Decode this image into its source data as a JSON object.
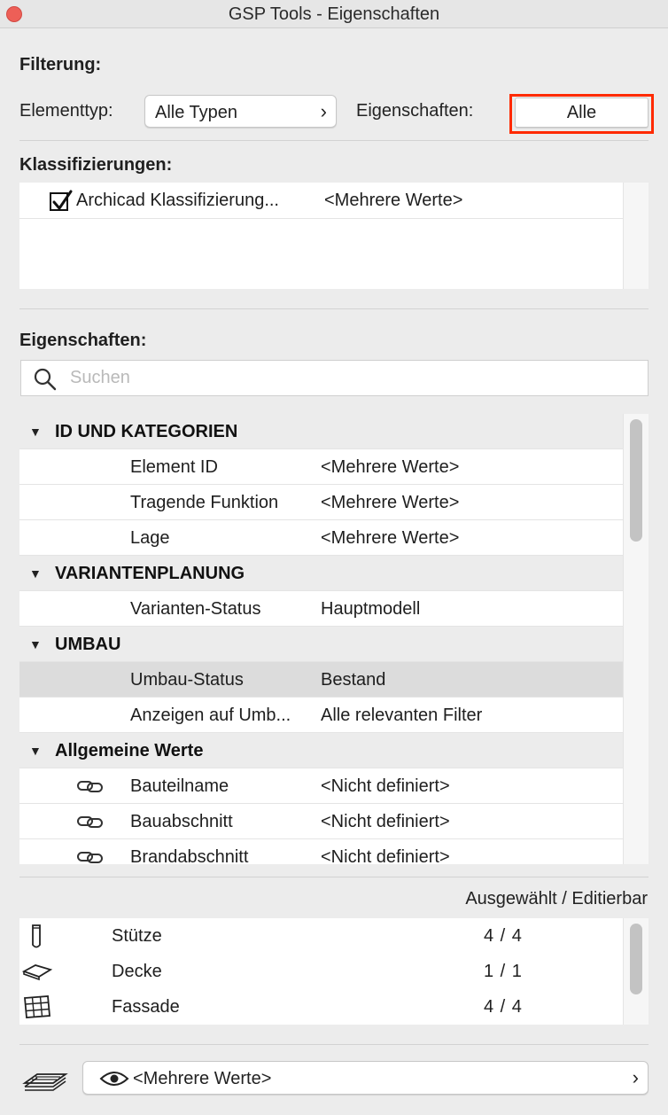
{
  "window": {
    "title": "GSP Tools - Eigenschaften"
  },
  "filter": {
    "heading": "Filterung:",
    "element_type_label": "Elementtyp:",
    "element_type_value": "Alle Typen",
    "properties_label": "Eigenschaften:",
    "properties_value": "Alle",
    "highlight_color": "#ff2a00"
  },
  "classifications": {
    "heading": "Klassifizierungen:",
    "items": [
      {
        "name": "Archicad Klassifizierung...",
        "value": "<Mehrere Werte>",
        "checked": true
      }
    ]
  },
  "properties": {
    "heading": "Eigenschaften:",
    "search_placeholder": "Suchen",
    "groups": [
      {
        "name": "ID UND KATEGORIEN",
        "items": [
          {
            "name": "Element ID",
            "value": "<Mehrere Werte>"
          },
          {
            "name": "Tragende Funktion",
            "value": "<Mehrere Werte>"
          },
          {
            "name": "Lage",
            "value": "<Mehrere Werte>"
          }
        ]
      },
      {
        "name": "VARIANTENPLANUNG",
        "items": [
          {
            "name": "Varianten-Status",
            "value": "Hauptmodell"
          }
        ]
      },
      {
        "name": "UMBAU",
        "items": [
          {
            "name": "Umbau-Status",
            "value": "Bestand",
            "selected": true
          },
          {
            "name": "Anzeigen auf Umb...",
            "value": "Alle relevanten Filter"
          }
        ]
      },
      {
        "name": "Allgemeine Werte",
        "items": [
          {
            "name": "Bauteilname",
            "value": "<Nicht definiert>",
            "icon": "link-icon"
          },
          {
            "name": "Bauabschnitt",
            "value": "<Nicht definiert>",
            "icon": "link-icon"
          },
          {
            "name": "Brandabschnitt",
            "value": "<Nicht definiert>",
            "icon": "link-icon"
          }
        ]
      }
    ]
  },
  "selection": {
    "header": "Ausgewählt / Editierbar",
    "items": [
      {
        "icon": "column-icon",
        "name": "Stütze",
        "count": "4 / 4"
      },
      {
        "icon": "slab-icon",
        "name": "Decke",
        "count": "1 / 1"
      },
      {
        "icon": "curtain-wall-icon",
        "name": "Fassade",
        "count": "4 / 4"
      }
    ]
  },
  "footer": {
    "layer_icon": "layers-icon",
    "eye_icon": "eye-icon",
    "value": "<Mehrere Werte>"
  }
}
